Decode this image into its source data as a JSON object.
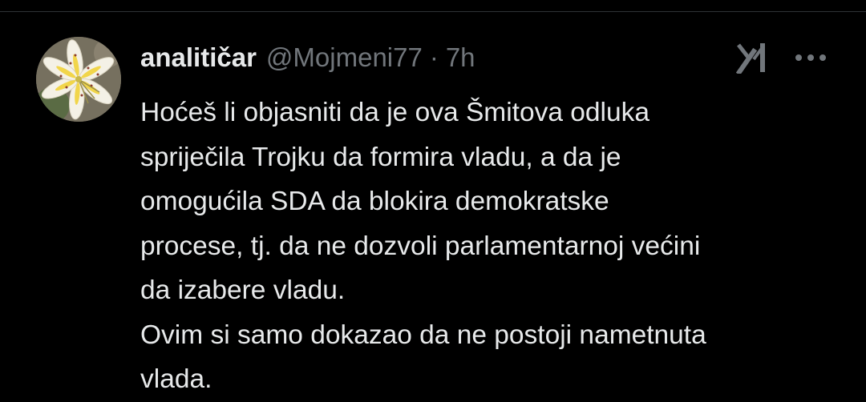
{
  "tweet": {
    "display_name": "analitičar",
    "handle": "@Mojmeni77",
    "separator": "·",
    "time": "7h",
    "text": "Hoćeš li objasniti da je ova Šmitova odluka\nspriječila Trojku da formira vladu, a da je\nomogućila SDA da blokira demokratske\nprocese, tj. da ne dozvoli parlamentarnoj većini\nda izabere vladu.\nOvim si samo dokazao da ne postoji nametnuta\nvlada."
  },
  "icons": {
    "avatar": "lily-flower-avatar",
    "grok": "grok-icon",
    "more": "more-options-icon"
  },
  "colors": {
    "background": "#000000",
    "primary_text": "#e7e9ea",
    "secondary_text": "#71767b",
    "divider": "#2f3336"
  }
}
